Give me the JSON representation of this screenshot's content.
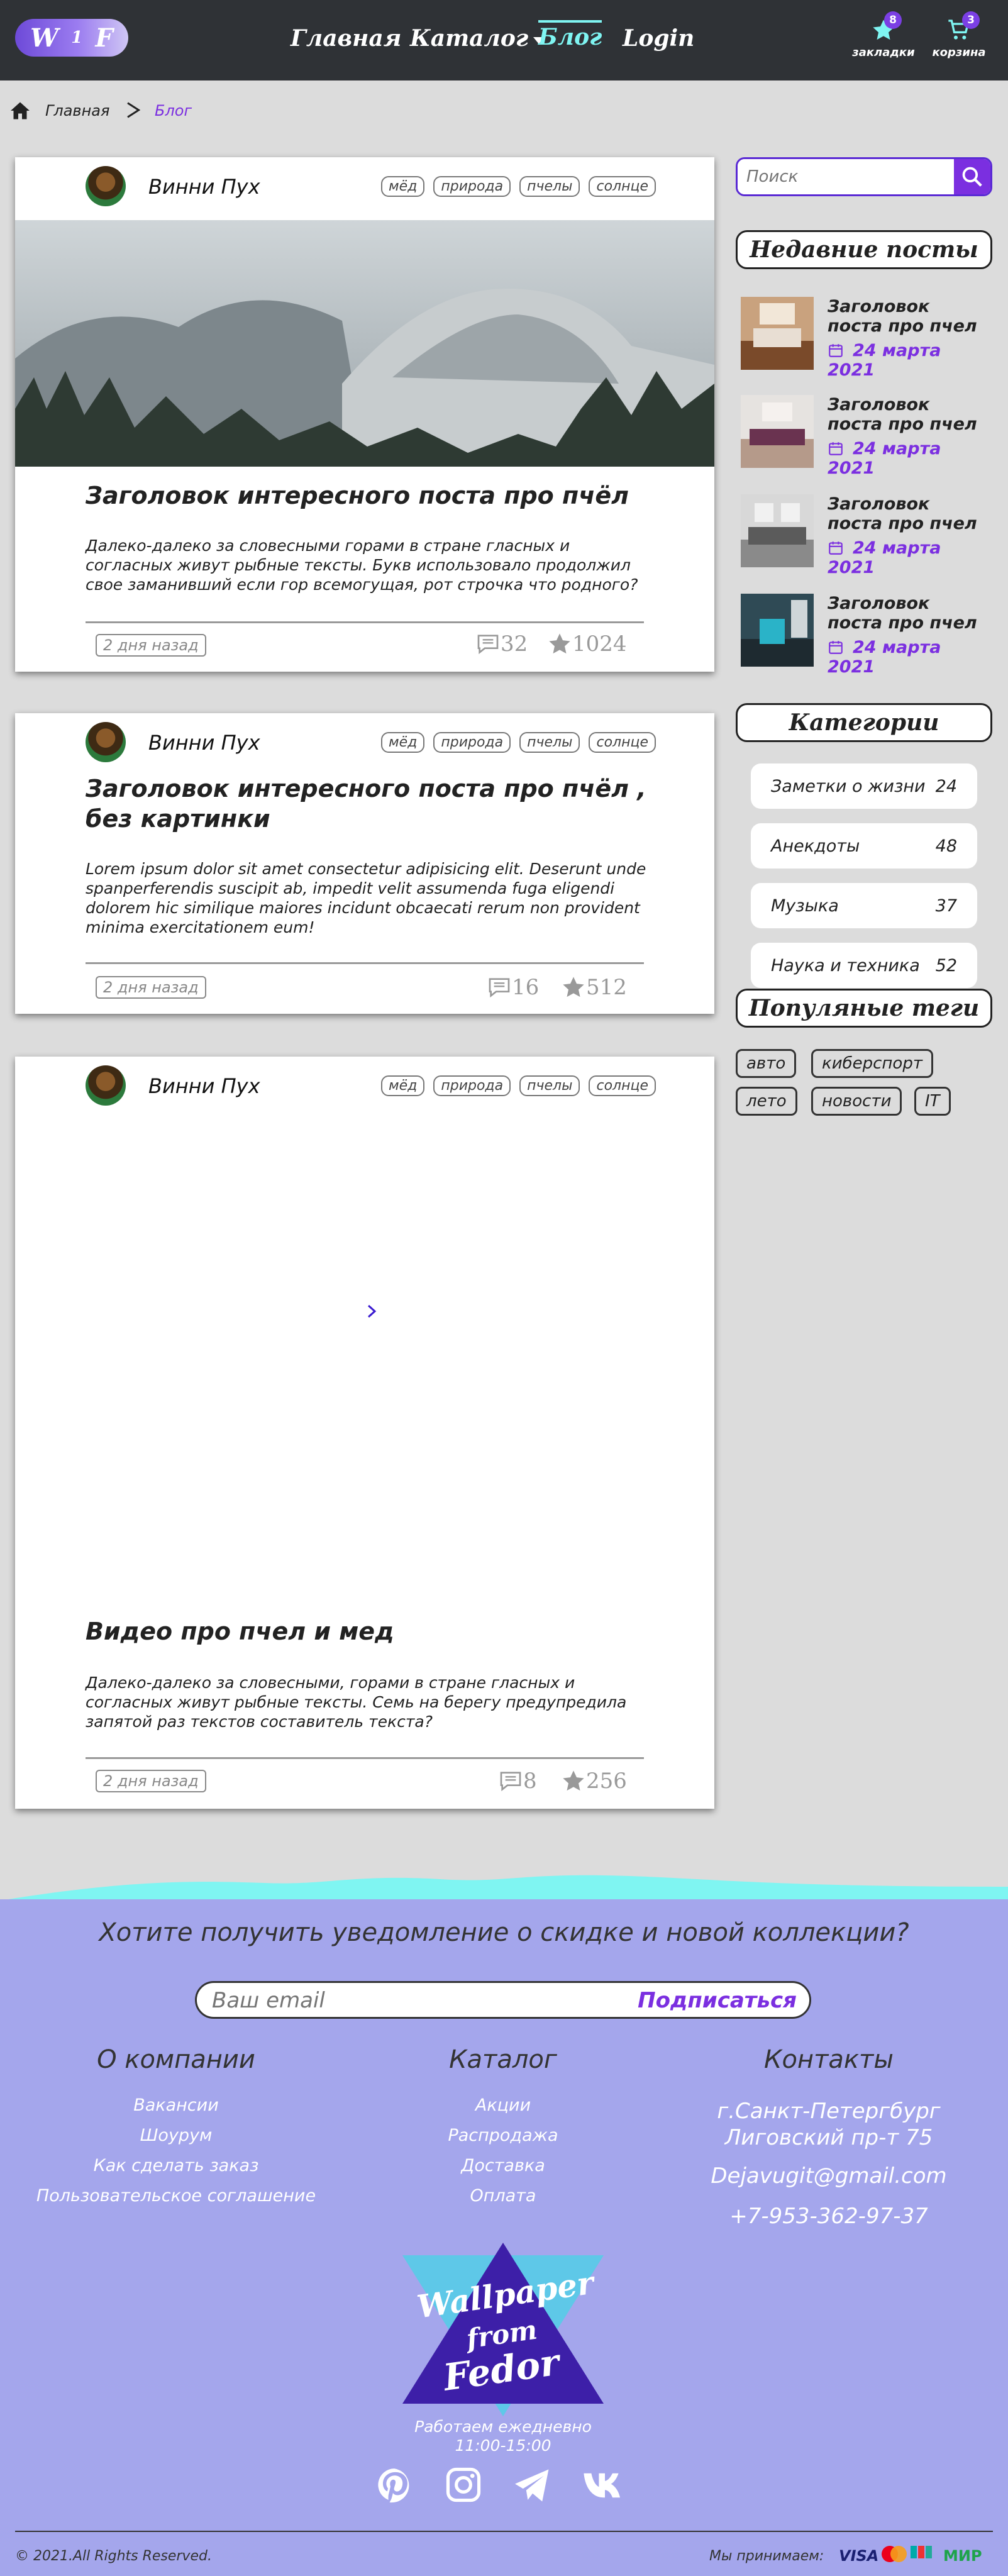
{
  "header": {
    "logo": {
      "l1": "W",
      "l2": "1",
      "l3": "F"
    },
    "nav": [
      {
        "label": "Главная"
      },
      {
        "label": "Каталог"
      },
      {
        "label": "Блог"
      },
      {
        "label": "Login"
      }
    ],
    "bookmarks": {
      "label": "закладки",
      "count": "8"
    },
    "cart": {
      "label": "корзина",
      "count": "3"
    }
  },
  "breadcrumb": {
    "home": "Главная",
    "current": "Блог"
  },
  "posts": [
    {
      "author": "Винни Пух",
      "tags": [
        "мёд",
        "природа",
        "пчелы",
        "солнце"
      ],
      "title": "Заголовок интересного поста про пчёл",
      "text": "Далеко-далеко за словесными горами в стране гласных и согласных живут рыбные тексты. Букв использовало продолжил свое заманивший если гор всемогущая, рот строчка что родного?",
      "ago": "2 дня назад",
      "comments": "32",
      "likes": "1024"
    },
    {
      "author": "Винни Пух",
      "tags": [
        "мёд",
        "природа",
        "пчелы",
        "солнце"
      ],
      "title": "Заголовок интересного поста про пчёл , без картинки",
      "text": "Lorem ipsum dolor sit amet consectetur adipisicing elit. Deserunt unde spanperferendis suscipit ab, impedit velit assumenda fuga eligendi dolorem hic similique maiores incidunt obcaecati rerum non provident minima exercitationem eum!",
      "ago": "2 дня назад",
      "comments": "16",
      "likes": "512"
    },
    {
      "author": "Винни Пух",
      "tags": [
        "мёд",
        "природа",
        "пчелы",
        "солнце"
      ],
      "title": "Видео про пчел и мед",
      "text": "Далеко-далеко за словесными, горами в стране гласных и согласных живут рыбные тексты. Семь на берегу предупредила запятой раз текстов составитель текста?",
      "ago": "2 дня назад",
      "comments": "8",
      "likes": "256"
    }
  ],
  "sidebar": {
    "search_placeholder": "Поиск",
    "recent_title": "Недавние посты",
    "recent": [
      {
        "title": "Заголовок поста про пчел",
        "date": "24 марта 2021"
      },
      {
        "title": "Заголовок поста про пчел",
        "date": "24 марта 2021"
      },
      {
        "title": "Заголовок поста про пчел",
        "date": "24 марта 2021"
      },
      {
        "title": "Заголовок поста про пчел",
        "date": "24 марта 2021"
      }
    ],
    "categories_title": "Категории",
    "categories": [
      {
        "name": "Заметки о жизни",
        "count": "24"
      },
      {
        "name": "Анекдоты",
        "count": "48"
      },
      {
        "name": "Музыка",
        "count": "37"
      },
      {
        "name": "Наука и техника",
        "count": "52"
      }
    ],
    "tags_title": "Популяные теги",
    "tags": [
      "авто",
      "киберспорт",
      "лето",
      "новости",
      "IT"
    ]
  },
  "footer": {
    "subscribe_title": "Хотите получить уведомление о скидке и новой коллекции?",
    "email_placeholder": "Ваш email",
    "subscribe_button": "Подписаться",
    "about_title": "О компании",
    "about_links": [
      "Вакансии",
      "Шоурум",
      "Как сделать заказ",
      "Пользовательское соглашение"
    ],
    "catalog_title": "Каталог",
    "catalog_links": [
      "Акции",
      "Распродажа",
      "Доставка",
      "Оплата"
    ],
    "contacts_title": "Контакты",
    "address": "г.Санкт-Петергбург Лиговский пр-т 75",
    "email": "Dejavugit@gmail.com",
    "phone": "+7-953-362-97-37",
    "logo": {
      "l1": "Wallpaper",
      "l2": "from",
      "l3": "Fedor"
    },
    "hours_label": "Работаем ежедневно",
    "hours": "11:00-15:00",
    "copyright": "© 2021.All Rights Reserved.",
    "payment_label": "Мы принимаем:",
    "payment": [
      "VISA",
      "МИР"
    ]
  },
  "colors": {
    "accent": "#7b2fe0",
    "header_bg": "#2f3236",
    "footer_bg": "#a4a6ec",
    "active_nav": "#7ff5f2"
  }
}
